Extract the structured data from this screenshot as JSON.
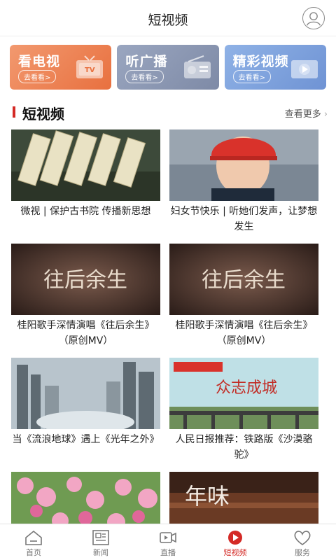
{
  "header": {
    "title": "短视频"
  },
  "entry_cards": [
    {
      "title": "看电视",
      "sub": "去看看>",
      "icon": "tv-icon"
    },
    {
      "title": "听广播",
      "sub": "去看看>",
      "icon": "radio-icon"
    },
    {
      "title": "精彩视频",
      "sub": "去看看>",
      "icon": "video-icon"
    }
  ],
  "section": {
    "title": "短视频",
    "more": "查看更多"
  },
  "videos": [
    {
      "caption": "微视 | 保护古书院 传播新思想"
    },
    {
      "caption": "妇女节快乐 | 听她们发声，让梦想发生"
    },
    {
      "caption": "桂阳歌手深情演唱《往后余生》（原创MV）",
      "thumb_text": "往后余生"
    },
    {
      "caption": "桂阳歌手深情演唱《往后余生》（原创MV）",
      "thumb_text": "往后余生"
    },
    {
      "caption": "当《流浪地球》遇上《光年之外》"
    },
    {
      "caption": "人民日报推荐：铁路版《沙漠骆驼》",
      "thumb_text": "众志成城"
    },
    {
      "caption": ""
    },
    {
      "caption": "",
      "thumb_text": "年味"
    }
  ],
  "tabs": [
    {
      "label": "首页",
      "icon": "home-icon"
    },
    {
      "label": "新闻",
      "icon": "news-icon"
    },
    {
      "label": "直播",
      "icon": "live-icon"
    },
    {
      "label": "短视频",
      "icon": "short-video-icon",
      "active": true
    },
    {
      "label": "服务",
      "icon": "heart-icon"
    }
  ],
  "colors": {
    "accent": "#d42a26"
  }
}
